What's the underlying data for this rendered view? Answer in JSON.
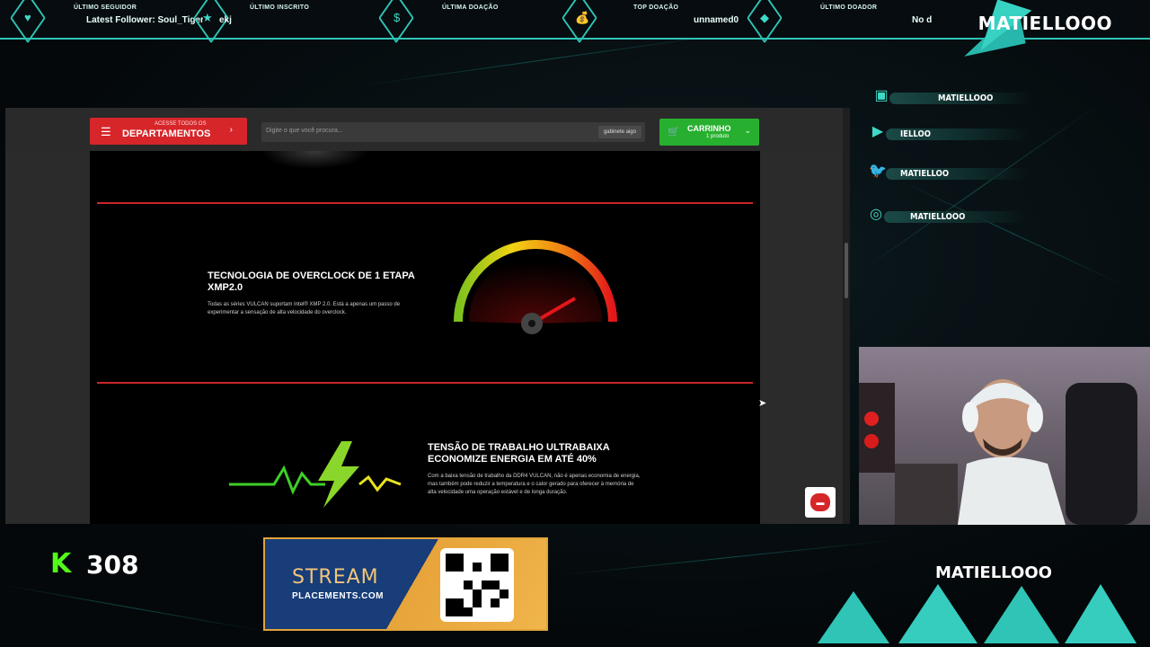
{
  "top_bar": {
    "alerts": [
      {
        "title": "ÚLTIMO SEGUIDOR",
        "value": "Latest Follower: Soul_Tiger",
        "icon": "heart-icon"
      },
      {
        "title": "ÚLTIMO INSCRITO",
        "value": "ekj",
        "icon": "star-icon"
      },
      {
        "title": "ÚLTIMA DOAÇÃO",
        "value": "",
        "icon": "dollar-icon"
      },
      {
        "title": "TOP DOAÇÃO",
        "value": "unnamed0",
        "icon": "money-bag-icon"
      },
      {
        "title": "ÚLTIMO DOADOR",
        "value": "No d",
        "icon": "diamond-icon"
      }
    ],
    "brand": "MATIELLOOO"
  },
  "store": {
    "departments": {
      "small": "ACESSE TODOS OS",
      "label": "DEPARTAMENTOS"
    },
    "search": {
      "placeholder": "Digite o que você procura...",
      "suggestion": "gabinete aigo"
    },
    "cart": {
      "label": "CARRINHO",
      "count": "1 produto"
    },
    "features": [
      {
        "title": "TECNOLOGIA DE OVERCLOCK DE 1 ETAPA XMP2.0",
        "text": "Todas as séries VULCAN suportam Intel® XMP 2.0. Está a apenas um passo de experimentar a sensação de alta velocidade do overclock."
      },
      {
        "title": "TENSÃO DE TRABALHO ULTRABAIXA ECONOMIZE ENERGIA EM ATÉ 40%",
        "text": "Com a baixa tensão de trabalho da DDR4 VULCAN, não é apenas economia de energia, mas também pode reduzir a temperatura e o calor gerado para oferecer à memória de alta velocidade uma operação estável e de longa duração."
      }
    ]
  },
  "socials": [
    {
      "name": "MATIELLOOO",
      "icon": "twitch-icon"
    },
    {
      "name": "IELLOO",
      "icon": "youtube-icon"
    },
    {
      "name": "MATIELLOO",
      "icon": "twitter-icon"
    },
    {
      "name": "MATIELLOOO",
      "icon": "instagram-icon"
    }
  ],
  "kick": {
    "count": "308",
    "icon": "kick-logo-icon",
    "letter": "K"
  },
  "ad": {
    "line1": "STREAM",
    "line2": "PLACEMENTS.COM"
  },
  "bottom_name": "MATIELLOOO",
  "colors": {
    "accent": "#2fc4b6",
    "store_red": "#d6262a",
    "cart_green": "#27b02f",
    "kick_green": "#53fc18"
  }
}
